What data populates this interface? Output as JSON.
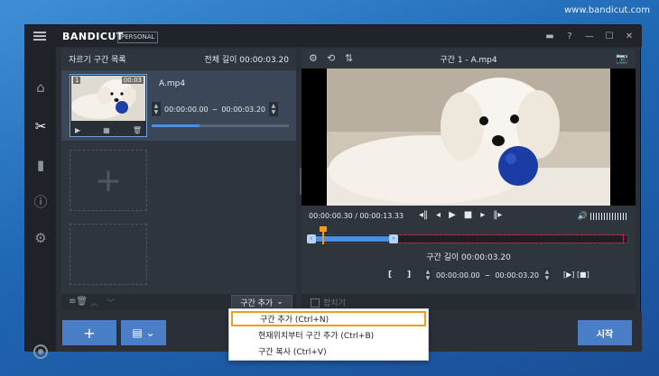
{
  "watermark": "www.bandicut.com",
  "app": {
    "logo_prefix": "BANDI",
    "logo_suffix": "CUT",
    "edition": "PERSONAL"
  },
  "window_controls": [
    "folder-icon",
    "help-icon",
    "minimize-icon",
    "maximize-icon",
    "close-icon"
  ],
  "sidebar": {
    "items": [
      "home-icon",
      "cut-icon",
      "split-icon",
      "info-icon",
      "settings-icon"
    ],
    "active": "cut-icon"
  },
  "left_panel": {
    "title": "자르기 구간 목록",
    "total_length": "전체 길이 00:00:03.20",
    "clip": {
      "number": "1",
      "duration": "00:03",
      "name": "A.mp4",
      "start": "00:00:00.00",
      "sep": "~",
      "end": "00:00:03.20",
      "progress": 0.35
    },
    "add_section_label": "구간 추가"
  },
  "right_panel": {
    "title": "구간 1 - A.mp4",
    "current_time": "00:00:00.30 / 00:00:13.33",
    "section_length": "구간 길이 00:00:03.20",
    "range": {
      "start": "00:00:00.00",
      "sep": "~",
      "end": "00:00:03.20"
    },
    "bracket_left": "[",
    "bracket_right": "]",
    "play_selection": "[▶] [■]",
    "merge_label": "합치기"
  },
  "footer": {
    "start_label": "시작"
  },
  "dropdown": {
    "items": [
      {
        "label": "구간 추가 (Ctrl+N)"
      },
      {
        "label": "현재위치부터 구간 추가 (Ctrl+B)"
      },
      {
        "label": "구간 복사 (Ctrl+V)"
      }
    ]
  }
}
